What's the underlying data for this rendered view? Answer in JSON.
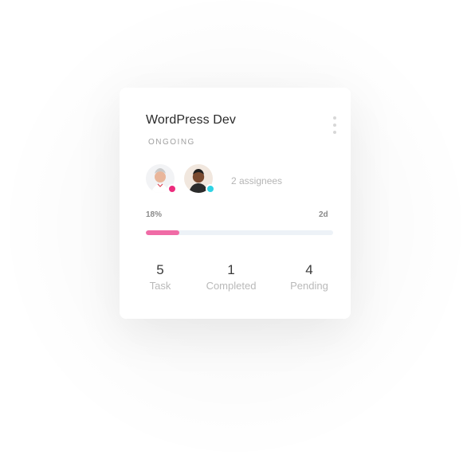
{
  "card": {
    "title": "WordPress Dev",
    "status": "ONGOING",
    "assignees_text": "2 assignees",
    "avatars": [
      {
        "name": "Assignee 1",
        "presence_color": "#ec2c7d"
      },
      {
        "name": "Assignee 2",
        "presence_color": "#2fd3e4"
      }
    ],
    "progress": {
      "percent_label": "18%",
      "time_left": "2d",
      "value": 0.18,
      "fill_color": "#f06ba6",
      "track_color": "#edf2f7"
    },
    "stats": {
      "task": {
        "value": "5",
        "label": "Task"
      },
      "completed": {
        "value": "1",
        "label": "Completed"
      },
      "pending": {
        "value": "4",
        "label": "Pending"
      }
    }
  },
  "icons": {
    "menu": "kebab-menu-icon"
  }
}
